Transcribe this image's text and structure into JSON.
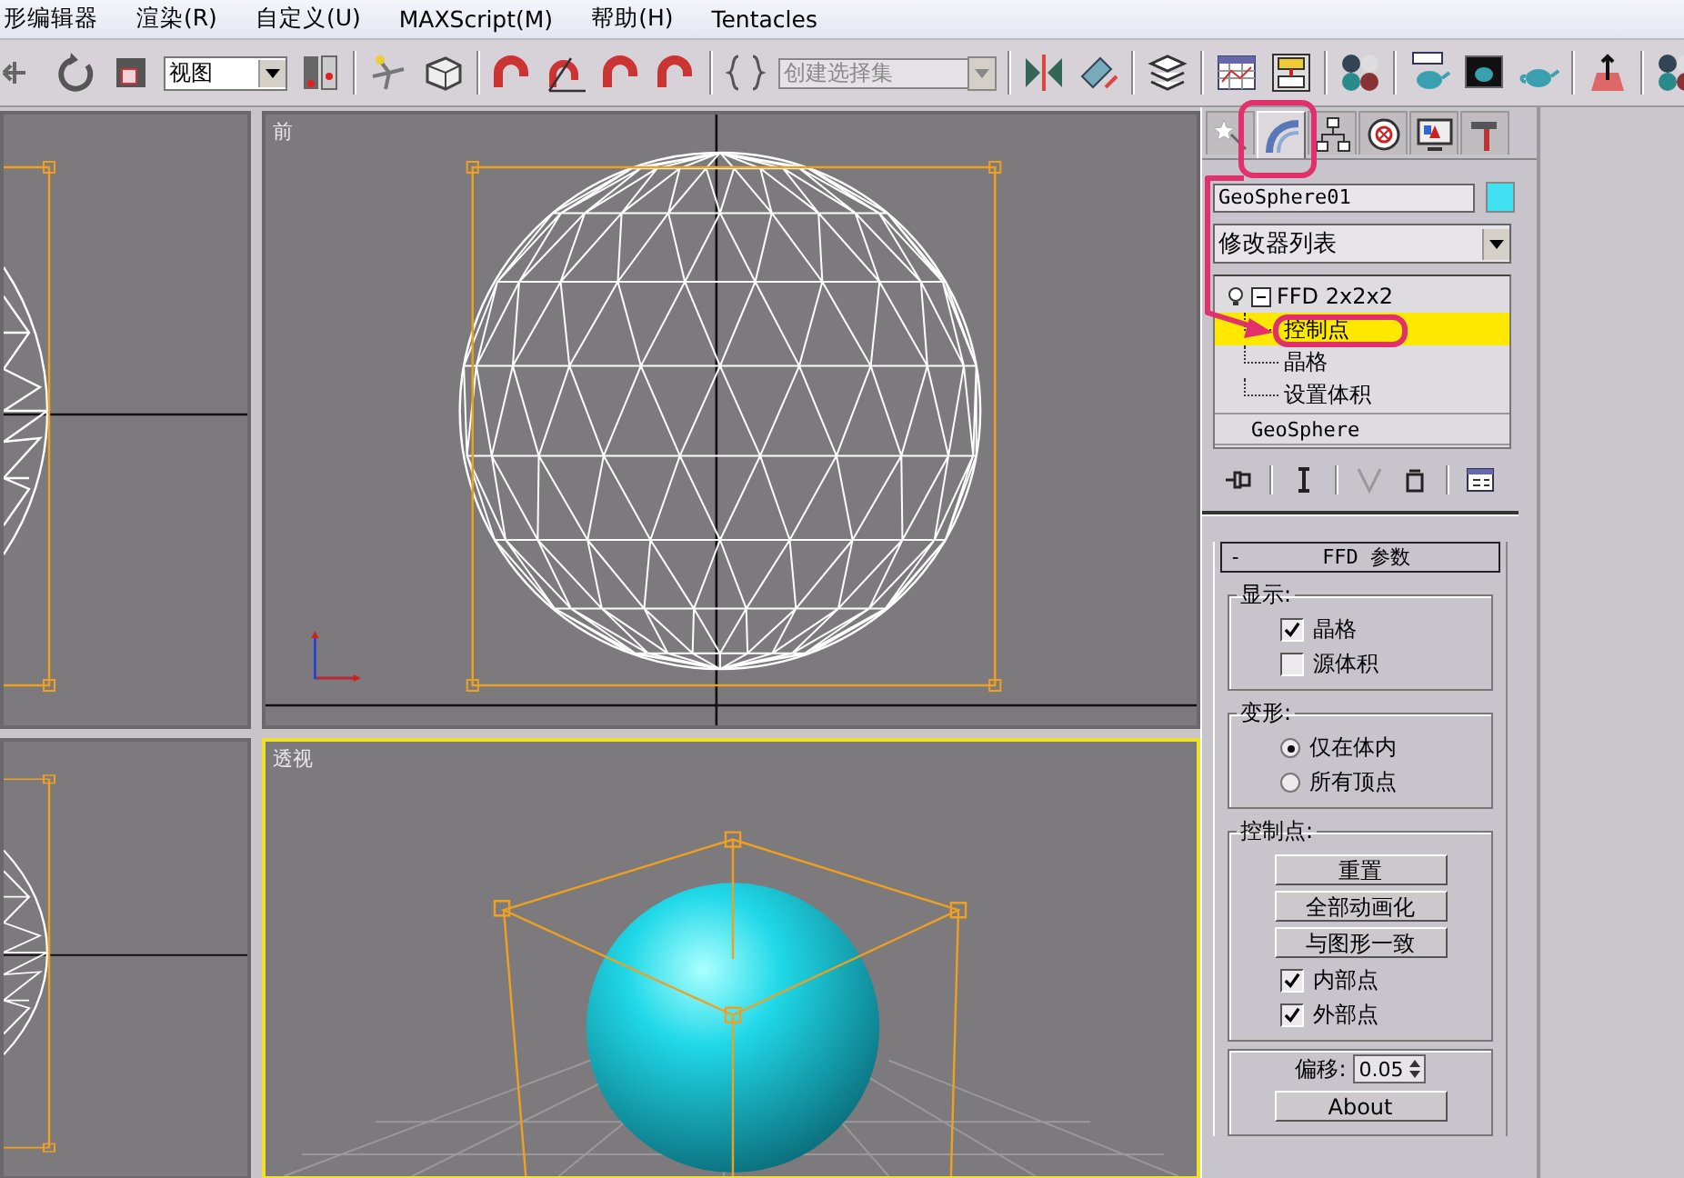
{
  "menu": [
    "形编辑器",
    "渲染(R)",
    "自定义(U)",
    "MAXScript(M)",
    "帮助(H)",
    "Tentacles"
  ],
  "toolbar": {
    "view_dropdown": "视图",
    "selection_set": {
      "placeholder": "创建选择集"
    }
  },
  "viewports": [
    {
      "kind": "side",
      "active": false
    },
    {
      "kind": "front",
      "label": "前",
      "active": false
    },
    {
      "kind": "side",
      "active": false
    },
    {
      "kind": "perspective",
      "label": "透视",
      "active": true
    }
  ],
  "command_panel": {
    "tabs": [
      {
        "kind": "create",
        "selected": false
      },
      {
        "kind": "modify",
        "selected": true
      },
      {
        "kind": "hierarchy",
        "selected": false
      },
      {
        "kind": "motion",
        "selected": false
      },
      {
        "kind": "display",
        "selected": false
      },
      {
        "kind": "utilities",
        "selected": false
      }
    ],
    "object_name": "GeoSphere01",
    "modifier_list": "修改器列表",
    "stack": [
      {
        "label": "FFD 2x2x2",
        "expanded": true,
        "selected": false,
        "children": [
          {
            "label": "控制点",
            "selected": true
          },
          {
            "label": "晶格",
            "selected": false
          },
          {
            "label": "设置体积",
            "selected": false
          }
        ]
      },
      {
        "label": "GeoSphere",
        "selected": false
      }
    ],
    "rollout": {
      "collapse_sign": "-",
      "title": "FFD 参数",
      "groups": [
        {
          "label": "显示:",
          "items": [
            {
              "kind": "checkbox",
              "label": "晶格",
              "checked": true
            },
            {
              "kind": "checkbox",
              "label": "源体积",
              "checked": false
            }
          ]
        },
        {
          "label": "变形:",
          "items": [
            {
              "kind": "radio",
              "label": "仅在体内",
              "selected": true
            },
            {
              "kind": "radio",
              "label": "所有顶点",
              "selected": false
            }
          ]
        },
        {
          "label": "控制点:",
          "items": [
            {
              "kind": "button",
              "label": "重置"
            },
            {
              "kind": "button",
              "label": "全部动画化"
            },
            {
              "kind": "button",
              "label": "与图形一致"
            },
            {
              "kind": "checkbox",
              "label": "内部点",
              "checked": true
            },
            {
              "kind": "checkbox",
              "label": "外部点",
              "checked": true
            }
          ]
        },
        {
          "items": [
            {
              "kind": "spinner",
              "label": "偏移:",
              "value": "0.05"
            },
            {
              "kind": "button",
              "label": "About"
            }
          ]
        }
      ]
    }
  }
}
